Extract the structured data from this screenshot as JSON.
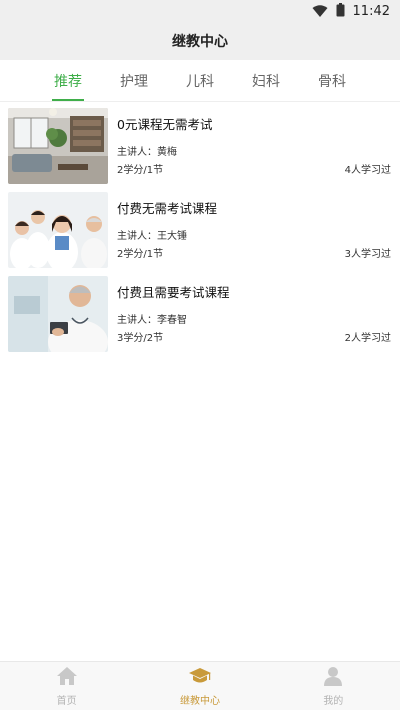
{
  "status_bar": {
    "time": "11:42",
    "icons": [
      "wifi-icon",
      "battery-icon"
    ]
  },
  "header": {
    "title": "继教中心"
  },
  "tabs": [
    {
      "label": "推荐",
      "active": true
    },
    {
      "label": "护理",
      "active": false
    },
    {
      "label": "儿科",
      "active": false
    },
    {
      "label": "妇科",
      "active": false
    },
    {
      "label": "骨科",
      "active": false
    }
  ],
  "courses": [
    {
      "title": "0元课程无需考试",
      "lecturer": "主讲人：黄梅",
      "credits": "2学分/1节",
      "learners": "4人学习过",
      "thumbnail": "living-room-image"
    },
    {
      "title": "付费无需考试课程",
      "lecturer": "主讲人：王大锤",
      "credits": "2学分/1节",
      "learners": "3人学习过",
      "thumbnail": "medical-team-image"
    },
    {
      "title": "付费且需要考试课程",
      "lecturer": "主讲人：李春智",
      "credits": "3学分/2节",
      "learners": "2人学习过",
      "thumbnail": "doctor-tablet-image"
    }
  ],
  "bottom_nav": [
    {
      "label": "首页",
      "icon": "home-icon",
      "active": false
    },
    {
      "label": "继教中心",
      "icon": "graduation-cap-icon",
      "active": true
    },
    {
      "label": "我的",
      "icon": "user-icon",
      "active": false
    }
  ],
  "colors": {
    "accent_green": "#3fae4a",
    "accent_gold": "#c99a3a",
    "inactive": "#b3b3b3"
  }
}
